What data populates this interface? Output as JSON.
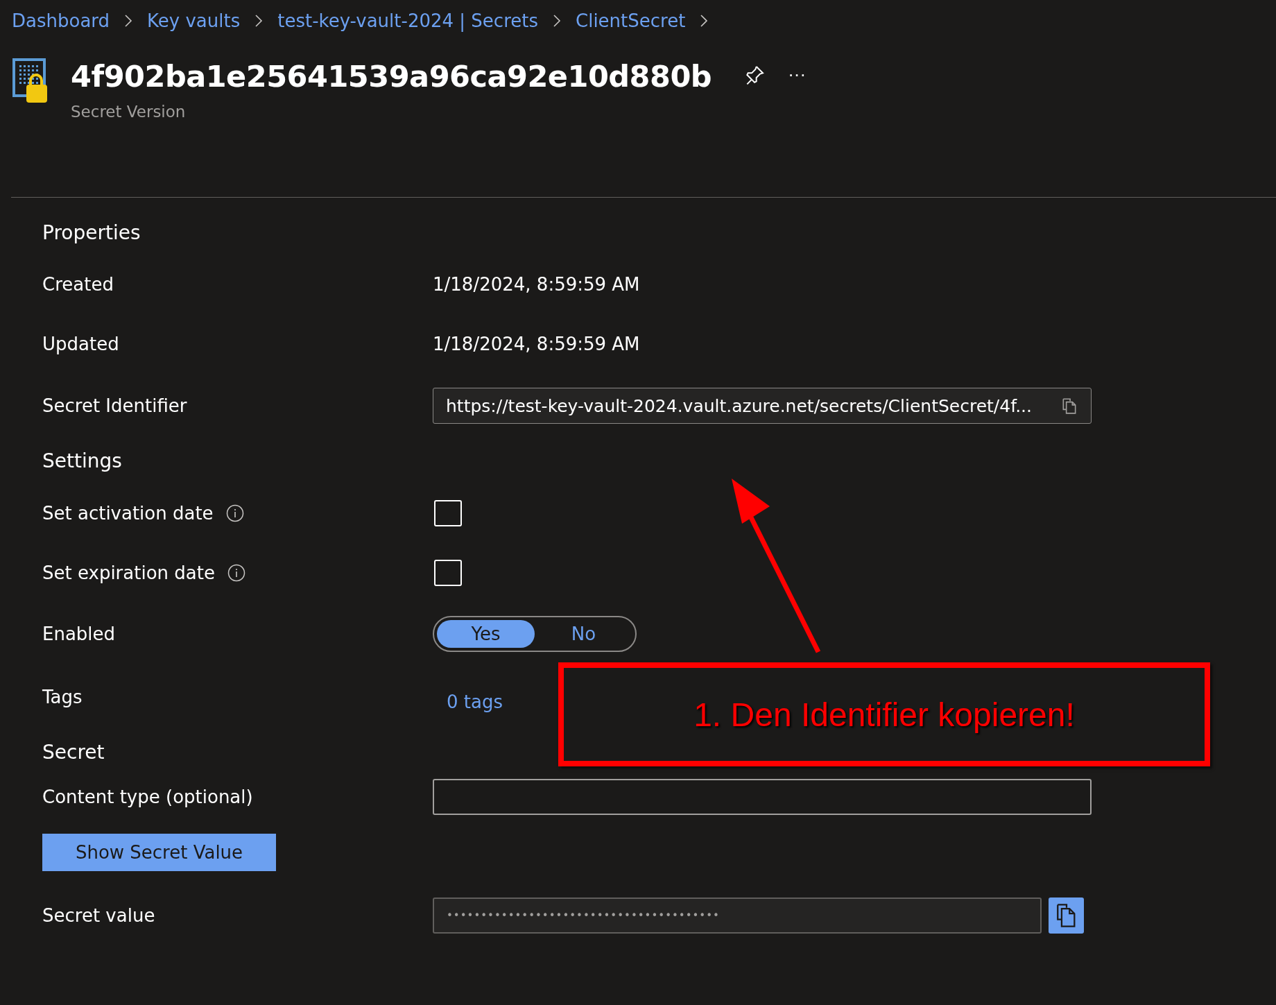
{
  "breadcrumb": [
    {
      "label": "Dashboard"
    },
    {
      "label": "Key vaults"
    },
    {
      "label": "test-key-vault-2024 | Secrets"
    },
    {
      "label": "ClientSecret"
    }
  ],
  "header": {
    "title": "4f902ba1e25641539a96ca92e10d880b",
    "subtitle": "Secret Version",
    "more": "···"
  },
  "form": [
    {
      "kind": "heading",
      "label": "Properties"
    },
    {
      "kind": "text",
      "label": "Created",
      "value": "1/18/2024, 8:59:59 AM"
    },
    {
      "kind": "text",
      "label": "Updated",
      "value": "1/18/2024, 8:59:59 AM"
    },
    {
      "kind": "copy_field",
      "label": "Secret Identifier",
      "value": "https://test-key-vault-2024.vault.azure.net/secrets/ClientSecret/4f..."
    },
    {
      "kind": "heading",
      "label": "Settings"
    },
    {
      "kind": "checkbox",
      "label": "Set activation date",
      "info": true,
      "checked": false
    },
    {
      "kind": "checkbox",
      "label": "Set expiration date",
      "info": true,
      "checked": false
    },
    {
      "kind": "toggle",
      "label": "Enabled",
      "options": [
        {
          "label": "Yes",
          "selected": true
        },
        {
          "label": "No",
          "selected": false
        }
      ]
    },
    {
      "kind": "link",
      "label": "Tags",
      "value": "0 tags"
    },
    {
      "kind": "heading",
      "label": "Secret"
    },
    {
      "kind": "input",
      "label": "Content type (optional)"
    },
    {
      "kind": "button",
      "label": "Show Secret Value"
    },
    {
      "kind": "secret",
      "label": "Secret value",
      "value": "••••••••••••••••••••••••••••••••••••••••"
    }
  ],
  "annotation": {
    "text": "1. Den Identifier kopieren!"
  }
}
